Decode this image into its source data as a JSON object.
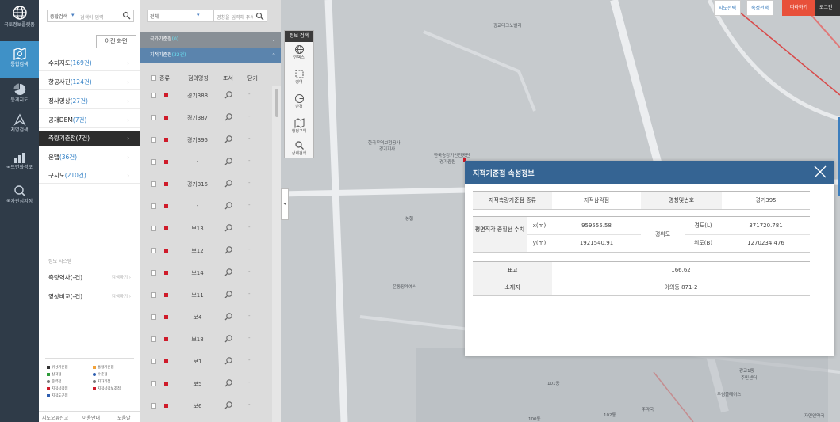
{
  "nav": {
    "logo_label": "국토정보플랫폼",
    "items": [
      {
        "label": "통합검색",
        "icon": "map-search-icon"
      },
      {
        "label": "통계지도",
        "icon": "pie-chart-icon"
      },
      {
        "label": "지명검색",
        "icon": "compass-icon"
      },
      {
        "label": "국토변화정보",
        "icon": "bar-chart-icon"
      },
      {
        "label": "국가관심지점",
        "icon": "location-search-icon"
      }
    ]
  },
  "search": {
    "type_select": "종합검색",
    "placeholder": "검색어 입력",
    "prev_button": "이전 화면"
  },
  "categories": [
    {
      "name": "수치지도",
      "count": "(169건)"
    },
    {
      "name": "항공사진",
      "count": "(124건)"
    },
    {
      "name": "정사영상",
      "count": "(27건)"
    },
    {
      "name": "공개DEM",
      "count": "(7건)"
    },
    {
      "name": "측량기준점",
      "count": "(7건)"
    },
    {
      "name": "온맵",
      "count": "(36건)"
    },
    {
      "name": "구지도",
      "count": "(210건)"
    }
  ],
  "sub_header": "정보 시스템",
  "extras": [
    {
      "name": "측량역사(-건)",
      "action": "검색하기 ›"
    },
    {
      "name": "영상비교(-건)",
      "action": "검색하기 ›"
    }
  ],
  "legend": [
    {
      "label": "위성기준점",
      "color": "#333333"
    },
    {
      "label": "통합기준점",
      "color": "#f2a23a"
    },
    {
      "label": "삼각점",
      "color": "#2e9b3a"
    },
    {
      "label": "수준점",
      "color": "#2f5fb0"
    },
    {
      "label": "중력점",
      "color": "#777777"
    },
    {
      "label": "지자기점",
      "color": "#777777"
    },
    {
      "label": "지적삼각점",
      "color": "#cf1b2a"
    },
    {
      "label": "지적삼각보조점",
      "color": "#cf1b2a"
    },
    {
      "label": "지적도근점",
      "color": "#2f5fb0"
    }
  ],
  "footer": {
    "link1": "지도오류신고",
    "link2": "이용안내",
    "link3": "도움말"
  },
  "results": {
    "filter_select": "전체",
    "name_placeholder": "명칭을 입력해 주세요",
    "bar1": {
      "label": "국가기준점",
      "count": "(0)"
    },
    "bar2": {
      "label": "지적기준점",
      "count": "(32건)"
    },
    "headers": {
      "type": "종류",
      "name": "점의명칭",
      "view": "조서",
      "close": "닫기"
    },
    "rows": [
      {
        "name": "경기388"
      },
      {
        "name": "경기387"
      },
      {
        "name": "경기395"
      },
      {
        "name": "-"
      },
      {
        "name": "경기315"
      },
      {
        "name": "-"
      },
      {
        "name": "보13"
      },
      {
        "name": "보12"
      },
      {
        "name": "보14"
      },
      {
        "name": "보11"
      },
      {
        "name": "보4"
      },
      {
        "name": "보18"
      },
      {
        "name": "보1"
      },
      {
        "name": "보5"
      },
      {
        "name": "보6"
      }
    ],
    "dash": "-"
  },
  "map": {
    "toolbar_title": "정보 검색",
    "tools": [
      {
        "label": "인덱스"
      },
      {
        "label": "영역"
      },
      {
        "label": "반경"
      },
      {
        "label": "행정구역"
      },
      {
        "label": "상세검색"
      }
    ],
    "labels": [
      {
        "text": "광교테크노밸리"
      },
      {
        "text": "한국무역보험공사"
      },
      {
        "text": "경기지사"
      },
      {
        "text": "한국승강기안전공단"
      },
      {
        "text": "경기중원"
      },
      {
        "text": "농협"
      },
      {
        "text": "은동장례예식"
      },
      {
        "text": "101동"
      },
      {
        "text": "102동"
      },
      {
        "text": "100동"
      },
      {
        "text": "주막국"
      },
      {
        "text": "광교1동"
      },
      {
        "text": "주민센터"
      },
      {
        "text": "두썸플레이스"
      },
      {
        "text": "자연앤약국"
      }
    ],
    "top_buttons": {
      "map_select": "지도선택",
      "attr_select": "속성선택",
      "follow": "따라하기",
      "login": "로그인"
    }
  },
  "popup": {
    "title": "지적기준점 속성정보",
    "type_label": "지적측량기준점 종류",
    "type_value": "지적삼각점",
    "name_label": "명칭및번호",
    "name_value": "경기395",
    "plane_label": "평면직각 종횡선 수치",
    "x_label": "x(m)",
    "x_value": "959555.58",
    "y_label": "y(m)",
    "y_value": "1921540.91",
    "latlon_label": "경위도",
    "lon_label": "경도(L)",
    "lon_value": "371720.781",
    "lat_label": "위도(B)",
    "lat_value": "1270234.476",
    "elev_label": "표고",
    "elev_value": "166.62",
    "addr_label": "소재지",
    "addr_value": "이의동 871-2"
  }
}
